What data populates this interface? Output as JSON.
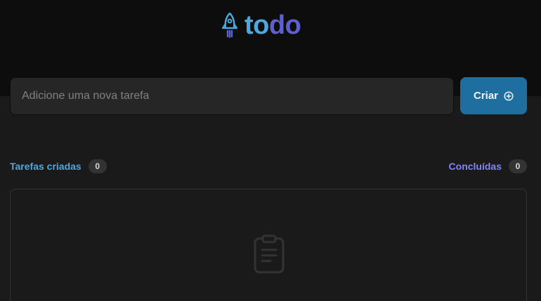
{
  "header": {
    "logo": {
      "icon": "rocket-icon",
      "text_part1": "to",
      "text_part2": "do",
      "colors": {
        "part1": "#4ea8de",
        "part2": "#5e60ce"
      }
    }
  },
  "new_task": {
    "placeholder": "Adicione uma nova tarefa",
    "value": ""
  },
  "create_button": {
    "label": "Criar",
    "icon": "plus-circle-icon",
    "color": "#1e6f9f"
  },
  "counters": {
    "created": {
      "label": "Tarefas criadas",
      "count": "0",
      "color": "#4ea8de"
    },
    "done": {
      "label": "Concluídas",
      "count": "0",
      "color": "#8284fa"
    }
  },
  "task_list": {
    "items": [],
    "empty_icon": "clipboard-icon"
  }
}
